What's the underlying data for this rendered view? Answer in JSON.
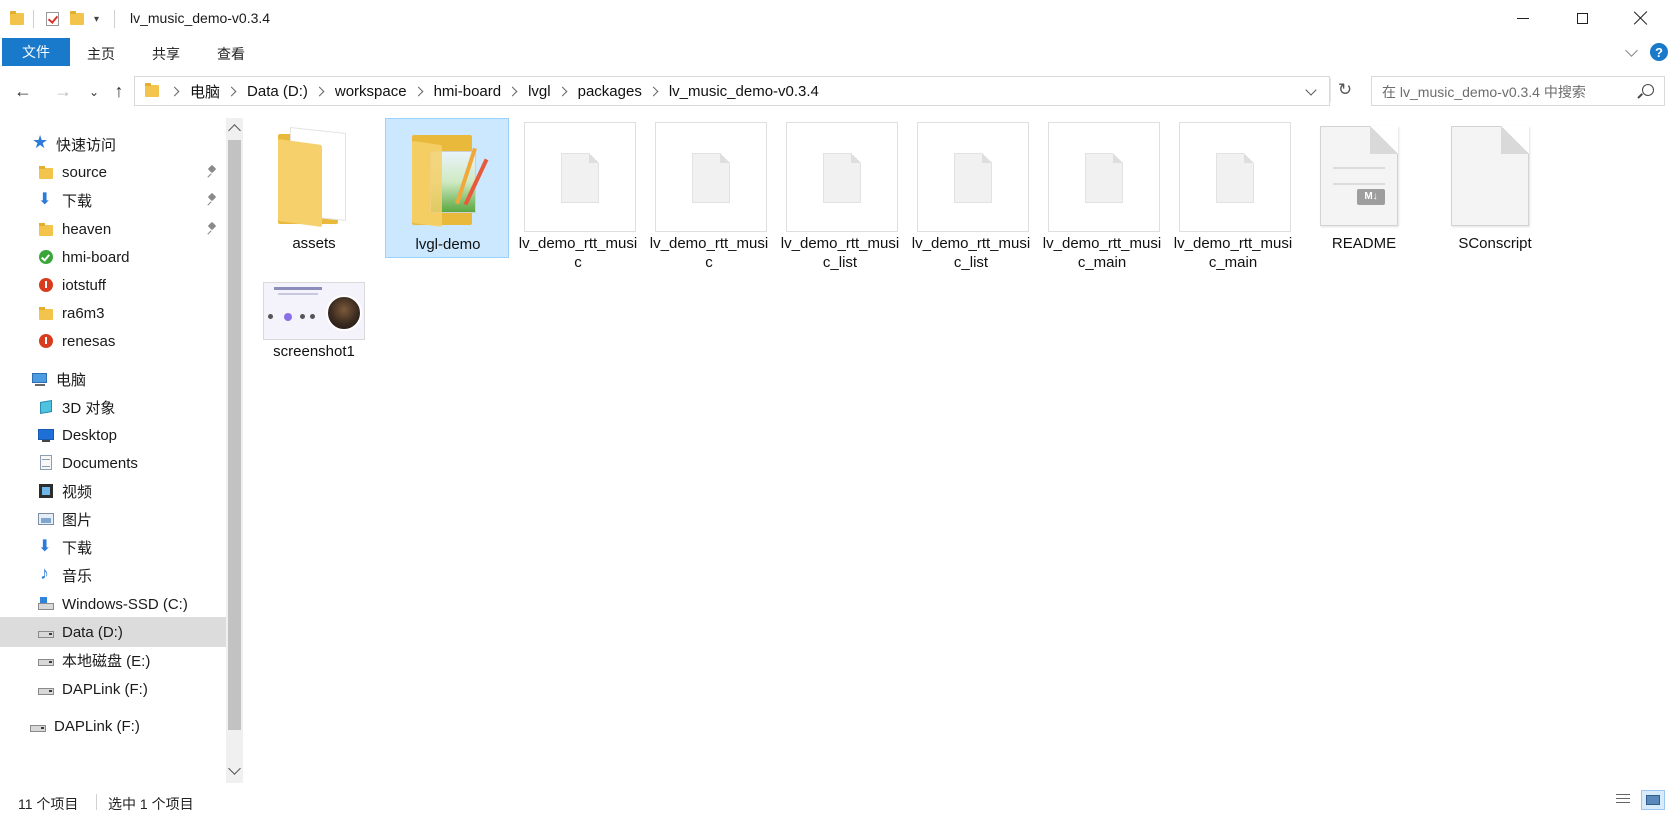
{
  "window": {
    "title": "lv_music_demo-v0.3.4"
  },
  "ribbon": {
    "file_tab": "文件",
    "tabs": [
      "主页",
      "共享",
      "查看"
    ],
    "help": "?"
  },
  "address": {
    "crumbs": [
      "电脑",
      "Data (D:)",
      "workspace",
      "hmi-board",
      "lvgl",
      "packages",
      "lv_music_demo-v0.3.4"
    ],
    "search_placeholder": "在 lv_music_demo-v0.3.4 中搜索"
  },
  "sidebar": {
    "items": [
      {
        "label": "快速访问",
        "icon": "star-icon",
        "level": 0
      },
      {
        "label": "source",
        "icon": "folder-icon",
        "level": 1,
        "pinned": true
      },
      {
        "label": "下载",
        "icon": "download-icon",
        "level": 1,
        "pinned": true
      },
      {
        "label": "heaven",
        "icon": "folder-icon",
        "level": 1,
        "pinned": true
      },
      {
        "label": "hmi-board",
        "icon": "green-check-folder-icon",
        "level": 1
      },
      {
        "label": "iotstuff",
        "icon": "red-alert-folder-icon",
        "level": 1
      },
      {
        "label": "ra6m3",
        "icon": "folder-icon",
        "level": 1
      },
      {
        "label": "renesas",
        "icon": "red-alert-folder-icon",
        "level": 1
      },
      {
        "label": "电脑",
        "icon": "computer-icon",
        "level": 0
      },
      {
        "label": "3D 对象",
        "icon": "3d-objects-icon",
        "level": 1
      },
      {
        "label": "Desktop",
        "icon": "desktop-icon",
        "level": 1
      },
      {
        "label": "Documents",
        "icon": "documents-icon",
        "level": 1
      },
      {
        "label": "视频",
        "icon": "video-icon",
        "level": 1
      },
      {
        "label": "图片",
        "icon": "pictures-icon",
        "level": 1
      },
      {
        "label": "下载",
        "icon": "download-icon",
        "level": 1
      },
      {
        "label": "音乐",
        "icon": "music-icon",
        "level": 1
      },
      {
        "label": "Windows-SSD (C:)",
        "icon": "windows-drive-icon",
        "level": 1
      },
      {
        "label": "Data (D:)",
        "icon": "drive-icon",
        "level": 1,
        "selected": true
      },
      {
        "label": "本地磁盘 (E:)",
        "icon": "drive-icon",
        "level": 1
      },
      {
        "label": "DAPLink (F:)",
        "icon": "drive-icon",
        "level": 1
      },
      {
        "label": "DAPLink (F:)",
        "icon": "drive-icon",
        "level": 0
      }
    ]
  },
  "files": [
    {
      "name": "assets",
      "kind": "folder"
    },
    {
      "name": "lvgl-demo",
      "kind": "folder-image",
      "selected": true
    },
    {
      "name": "lv_demo_rtt_music",
      "kind": "file"
    },
    {
      "name": "lv_demo_rtt_music",
      "kind": "file"
    },
    {
      "name": "lv_demo_rtt_music_list",
      "kind": "file"
    },
    {
      "name": "lv_demo_rtt_music_list",
      "kind": "file"
    },
    {
      "name": "lv_demo_rtt_music_main",
      "kind": "file"
    },
    {
      "name": "lv_demo_rtt_music_main",
      "kind": "file"
    },
    {
      "name": "README",
      "kind": "markdown",
      "badge": "M↓"
    },
    {
      "name": "SConscript",
      "kind": "page"
    },
    {
      "name": "screenshot1",
      "kind": "image"
    }
  ],
  "status": {
    "count": "11 个项目",
    "selected": "选中 1 个项目"
  }
}
